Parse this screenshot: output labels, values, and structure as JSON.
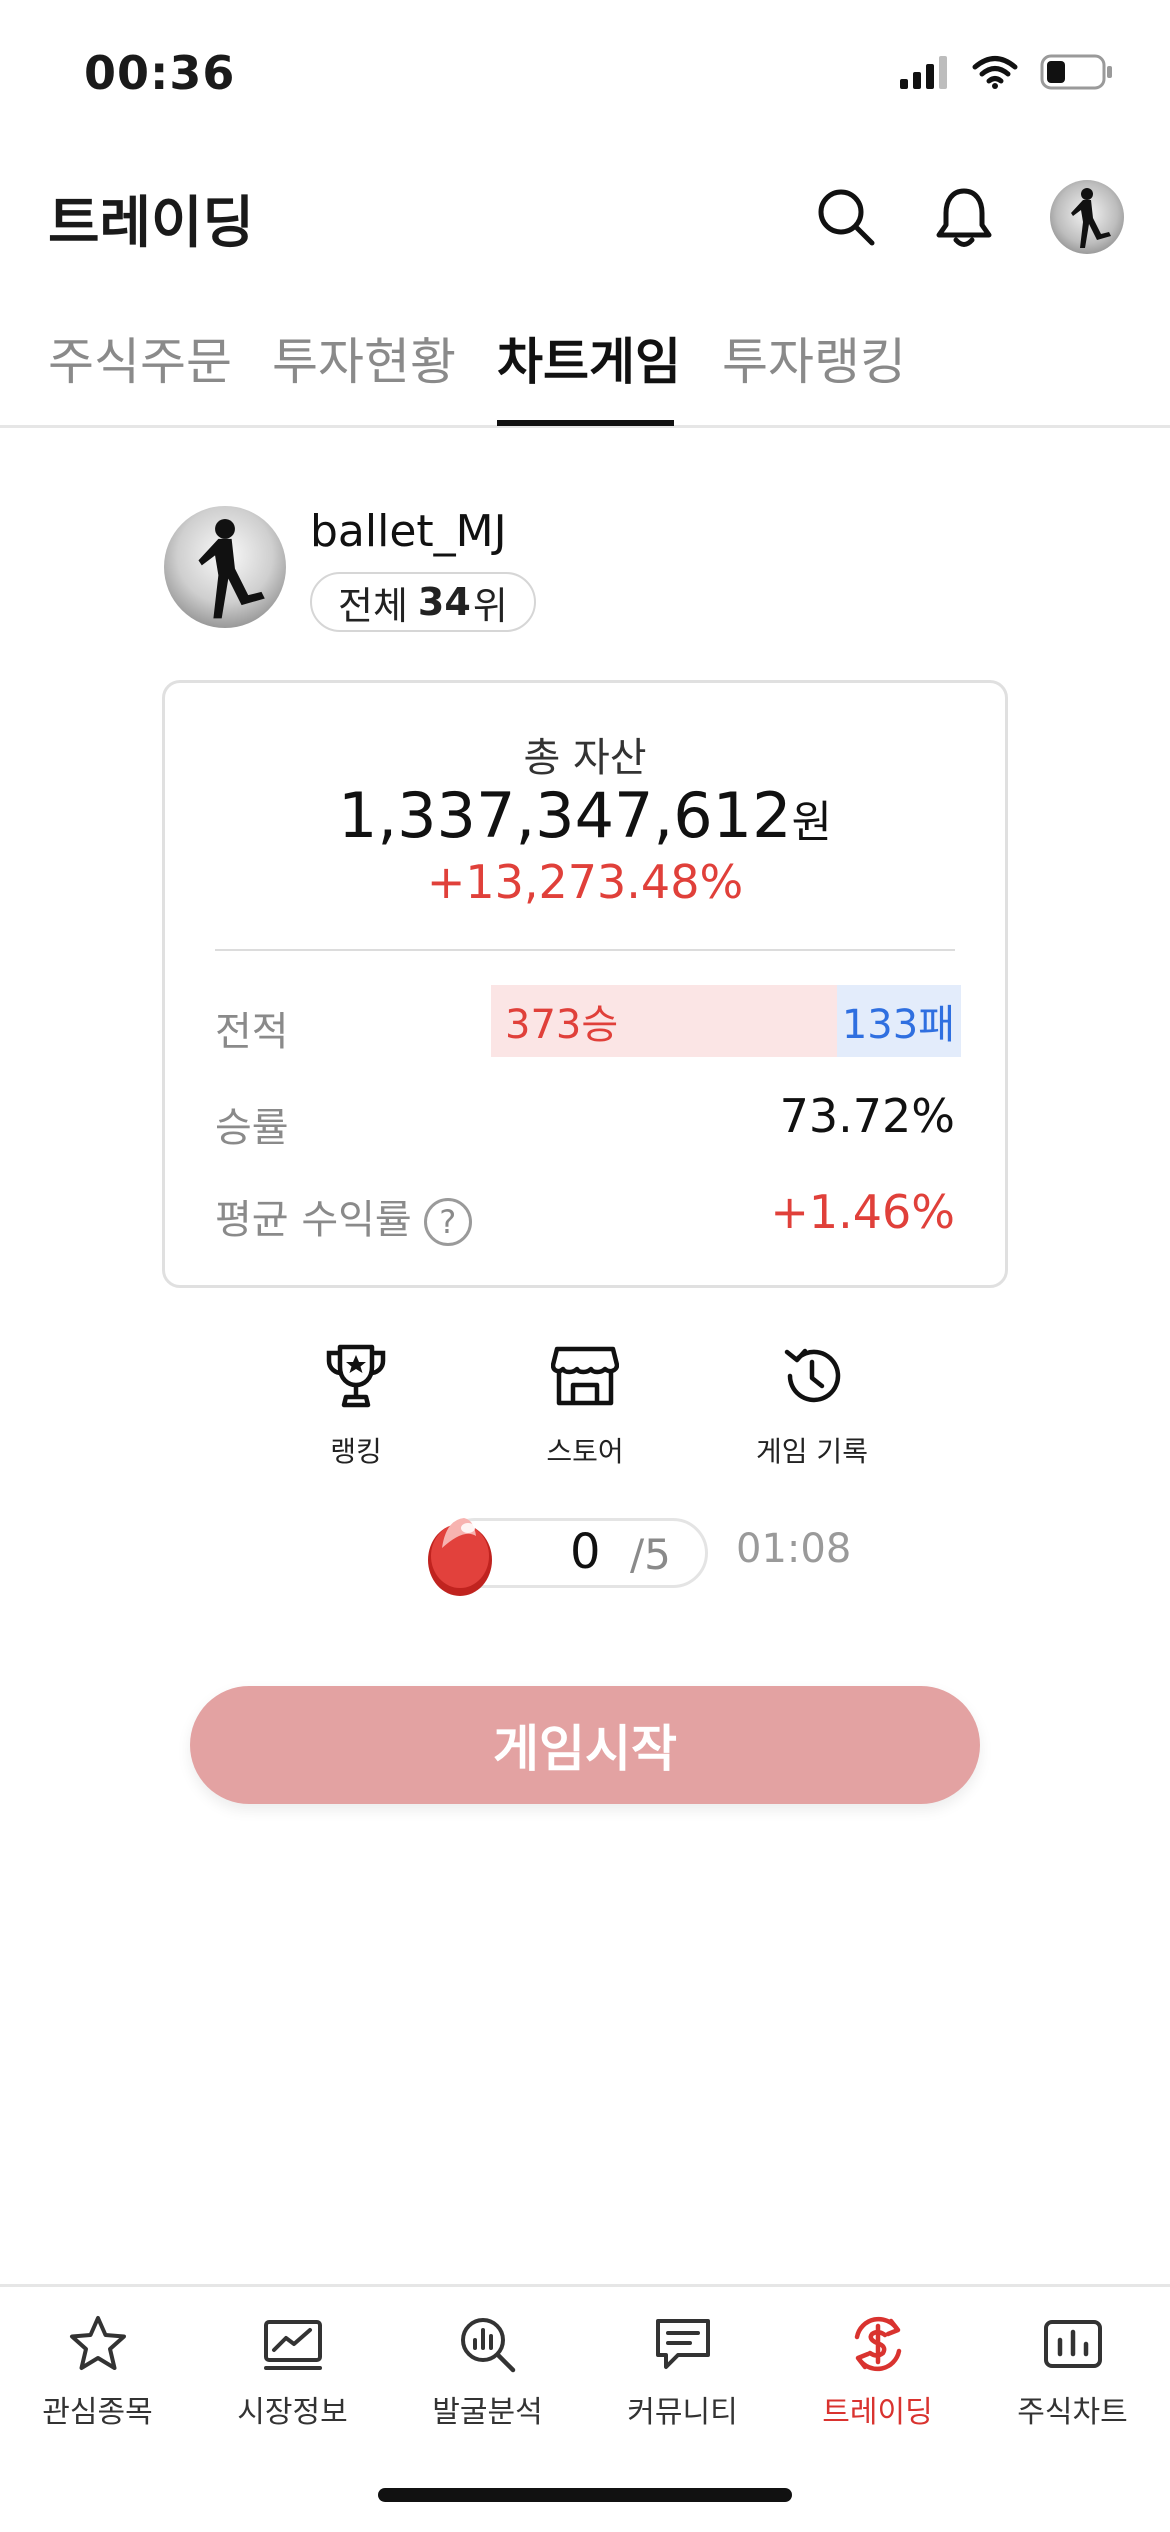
{
  "status_bar": {
    "time": "00:36",
    "icons": [
      "signal-icon",
      "wifi-icon",
      "battery-icon"
    ]
  },
  "header": {
    "title": "트레이딩",
    "icons": [
      "search-icon",
      "bell-icon",
      "profile-avatar"
    ]
  },
  "tabs": [
    {
      "label": "주식주문",
      "active": false
    },
    {
      "label": "투자현황",
      "active": false
    },
    {
      "label": "차트게임",
      "active": true
    },
    {
      "label": "투자랭킹",
      "active": false
    }
  ],
  "profile": {
    "username": "ballet_MJ",
    "rank_prefix": "전체",
    "rank_number": "34",
    "rank_suffix": "위"
  },
  "summary": {
    "total_assets_label": "총 자산",
    "total_assets_value": "1,337,347,612",
    "total_assets_unit": "원",
    "total_return": "+13,273.48%",
    "record_label": "전적",
    "wins": "373승",
    "losses": "133패",
    "win_fraction": 0.737,
    "win_rate_label": "승률",
    "win_rate": "73.72%",
    "avg_return_label": "평균 수익률",
    "help_icon": "?",
    "avg_return": "+1.46%"
  },
  "shortcuts": [
    {
      "label": "랭킹",
      "icon": "trophy-icon"
    },
    {
      "label": "스토어",
      "icon": "store-icon"
    },
    {
      "label": "게임 기록",
      "icon": "history-icon"
    }
  ],
  "egg_counter": {
    "count": "0",
    "max": "/5",
    "timer": "01:08",
    "icon": "red-egg-icon"
  },
  "start_button": {
    "label": "게임시작"
  },
  "bottom_nav": [
    {
      "label": "관심종목",
      "icon": "star-icon",
      "active": false
    },
    {
      "label": "시장정보",
      "icon": "market-chart-icon",
      "active": false
    },
    {
      "label": "발굴분석",
      "icon": "analysis-search-icon",
      "active": false
    },
    {
      "label": "커뮤니티",
      "icon": "chat-icon",
      "active": false
    },
    {
      "label": "트레이딩",
      "icon": "trading-dollar-icon",
      "active": true
    },
    {
      "label": "주식차트",
      "icon": "bar-chart-icon",
      "active": false
    }
  ],
  "colors": {
    "accent_red": "#e0403a",
    "accent_blue": "#2f6fe0",
    "start_button": "#e3a2a2",
    "nav_active": "#d9332f"
  }
}
